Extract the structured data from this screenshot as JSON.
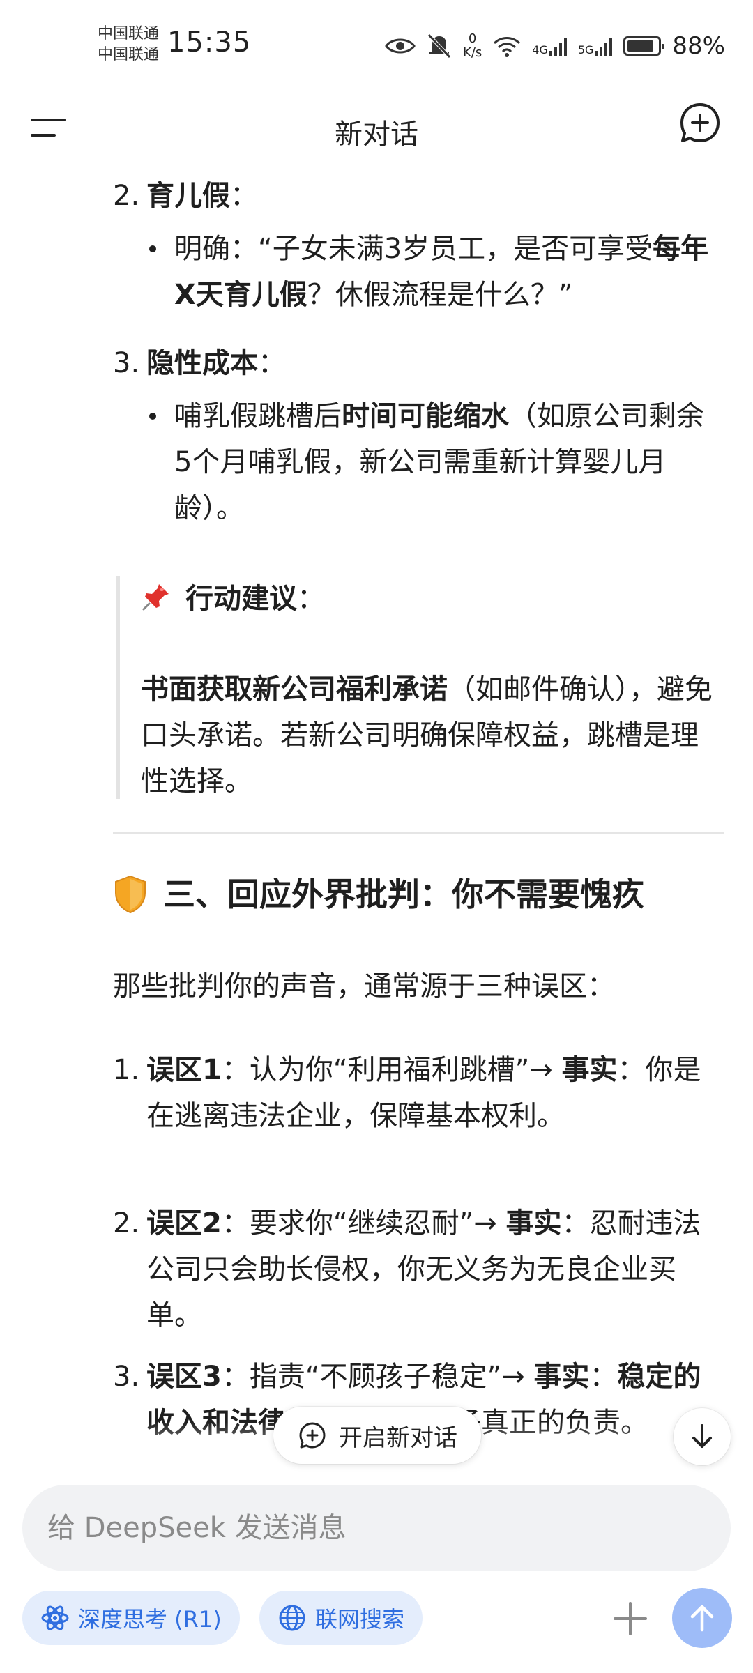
{
  "status_bar": {
    "carrier_1": "中国联通",
    "carrier_2": "中国联通",
    "time": "15:35",
    "net_speed_value": "0",
    "net_speed_unit": "K/s",
    "signal_1": "4G",
    "signal_2": "5G",
    "battery": "88%"
  },
  "header": {
    "title": "新对话"
  },
  "icons": {
    "menu": "menu-icon",
    "new_chat": "new-chat-icon",
    "pin": "pushpin-icon",
    "shield": "shield-icon",
    "scroll_down": "arrow-down-icon",
    "send": "arrow-up-icon"
  },
  "message": {
    "item2": {
      "num": "2.",
      "title": "育儿假",
      "colon": "：",
      "bullet_a": "明确：“子女未满3岁员工，是否可享受",
      "bullet_b": "每年X天育儿假",
      "bullet_c": "？休假流程是什么？”"
    },
    "item3": {
      "num": "3.",
      "title": "隐性成本",
      "colon": "：",
      "bullet_a": "哺乳假跳槽后",
      "bullet_b": "时间可能缩水",
      "bullet_c": "（如原公司剩余5个月哺乳假，新公司需重新计算婴儿月龄）。"
    },
    "quote": {
      "title": "行动建议",
      "colon": "：",
      "bold": "书面获取新公司福利承诺",
      "text": "（如邮件确认），避免口头承诺。若新公司明确保障权益，跳槽是理性选择。"
    },
    "section": {
      "title": "三、回应外界批判：你不需要愧疚",
      "intro": "那些批判你的声音，通常源于三种误区："
    },
    "myths": [
      {
        "num": "1.",
        "label": "误区1",
        "a": "：认为你“利用福利跳槽”→ ",
        "fact": "事实",
        "b": "：你是在逃离违法企业，保障基本权利。"
      },
      {
        "num": "2.",
        "label": "误区2",
        "a": "：要求你“继续忍耐”→ ",
        "fact": "事实",
        "b": "：忍耐违法公司只会助长侵权，你无义务为无良企业买单。"
      },
      {
        "num": "3.",
        "label": "误区3",
        "a": "：指责“不顾孩子稳定”→ ",
        "fact": "事实",
        "b": "：",
        "c": "稳定的收入和法律保障",
        "d": "才是对孩子真正的负责。"
      }
    ]
  },
  "floating": {
    "new_chat_label": "开启新对话"
  },
  "composer": {
    "placeholder": "给 DeepSeek 发送消息",
    "deep_think_label": "深度思考 (R1)",
    "web_search_label": "联网搜索"
  },
  "colors": {
    "accent": "#2f6ee0",
    "chip_bg": "#e4edfc",
    "send_bg": "#9ebcf8"
  }
}
